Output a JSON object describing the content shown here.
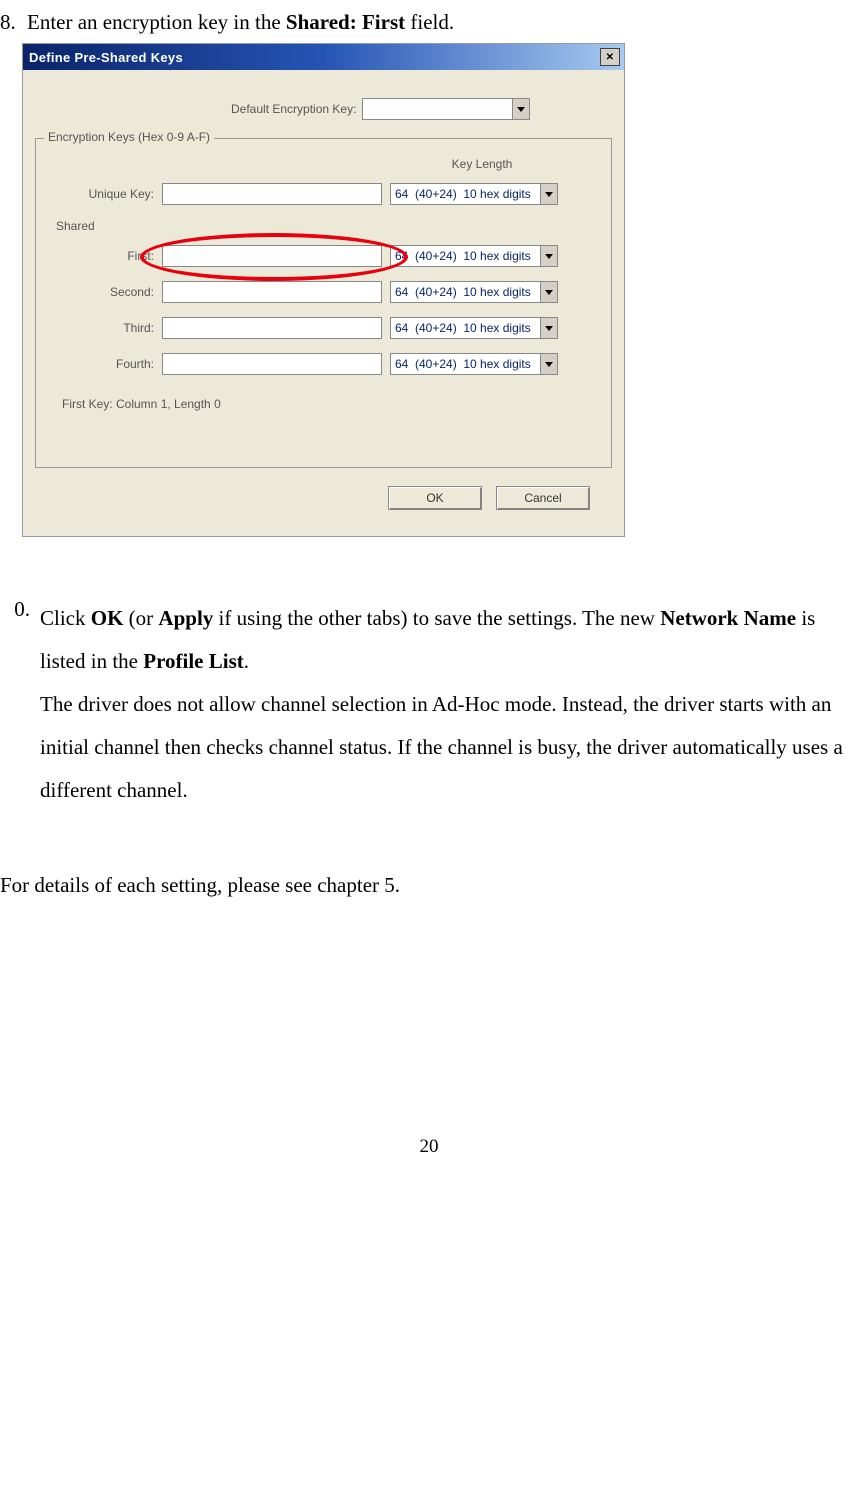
{
  "step8": {
    "number": "8.",
    "prefix": "Enter an encryption key in the ",
    "boldField": "Shared: First",
    "suffix": " field."
  },
  "dialog": {
    "title": "Define Pre-Shared Keys",
    "defaultLabel": "Default Encryption Key:",
    "defaultValue": "",
    "groupLegend": "Encryption Keys (Hex 0-9 A-F)",
    "keyLengthHeader": "Key Length",
    "sharedLabel": "Shared",
    "rows": {
      "unique": {
        "label": "Unique Key:",
        "value": "",
        "len": "64  (40+24)  10 hex digits"
      },
      "first": {
        "label": "First:",
        "value": "",
        "len": "64  (40+24)  10 hex digits"
      },
      "second": {
        "label": "Second:",
        "value": "",
        "len": "64  (40+24)  10 hex digits"
      },
      "third": {
        "label": "Third:",
        "value": "",
        "len": "64  (40+24)  10 hex digits"
      },
      "fourth": {
        "label": "Fourth:",
        "value": "",
        "len": "64  (40+24)  10 hex digits"
      }
    },
    "status": "First Key: Column 1,  Length 0",
    "ok": "OK",
    "cancel": "Cancel"
  },
  "step0": {
    "number": "0.",
    "t1": "Click ",
    "b1": "OK",
    "t2": " (or ",
    "b2": "Apply",
    "t3": " if using the other tabs) to save the settings. The new ",
    "b3": "Network Name",
    "t4": " is listed in the ",
    "b4": "Profile List",
    "t5": ".",
    "para2": "The driver does not allow channel selection in Ad-Hoc mode. Instead, the driver starts with an initial channel then checks channel status. If the channel is busy, the driver automatically uses a different channel."
  },
  "footer": "For details of each setting, please see chapter 5.",
  "pageNumber": "20"
}
